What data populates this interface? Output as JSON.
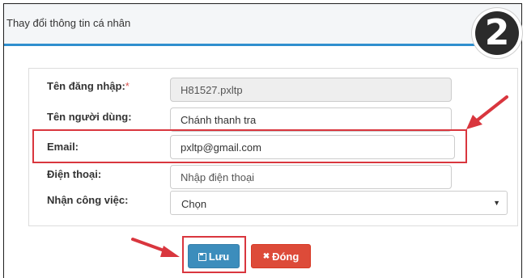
{
  "dialog": {
    "title": "Thay đổi thông tin cá nhân",
    "step_number": "2"
  },
  "form": {
    "username": {
      "label": "Tên đăng nhập:",
      "required_mark": "*",
      "value": "H81527.pxltp"
    },
    "display_name": {
      "label": "Tên người dùng:",
      "value": "Chánh thanh tra"
    },
    "email": {
      "label": "Email:",
      "value": "pxltp@gmail.com"
    },
    "phone": {
      "label": "Điện thoại:",
      "value": "",
      "placeholder": "Nhập điện thoại"
    },
    "receive_tasks": {
      "label": "Nhận công việc:",
      "selected": "Chọn"
    }
  },
  "buttons": {
    "save_label": "Lưu",
    "close_label": "Đóng",
    "close_icon_glyph": "✖"
  },
  "icons": {
    "save": "floppy-disk-icon",
    "close": "close-icon",
    "select_caret": "caret-down-icon"
  },
  "colors": {
    "accent_blue": "#3c8dbc",
    "danger_red": "#dd4b39",
    "annotation_red": "#d9363e",
    "title_divider": "#2f8fce"
  }
}
